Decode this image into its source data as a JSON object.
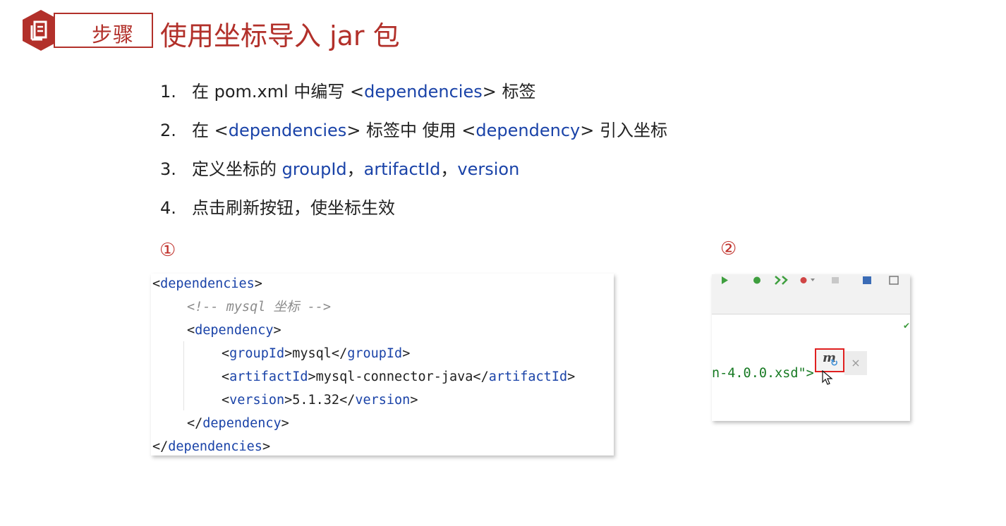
{
  "header": {
    "badge_label": "步骤",
    "title": "使用坐标导入 jar 包"
  },
  "steps": [
    {
      "num": "1.",
      "pre": "在 pom.xml 中编写 <",
      "kw1": "dependencies",
      "mid": "> 标签",
      "kw2": "",
      "post": ""
    },
    {
      "num": "2.",
      "pre": "在 <",
      "kw1": "dependencies",
      "mid": "> 标签中 使用 <",
      "kw2": "dependency",
      "post": "> 引入坐标"
    },
    {
      "num": "3.",
      "pre": "定义坐标的 ",
      "kw1": "groupId",
      "mid": "，",
      "kw2": "artifactId",
      "post": "，",
      "kw3": "version"
    },
    {
      "num": "4.",
      "pre": "点击刷新按钮，使坐标生效",
      "kw1": "",
      "mid": "",
      "kw2": "",
      "post": ""
    }
  ],
  "markers": {
    "one": "①",
    "two": "②"
  },
  "code": {
    "l1_open": "<",
    "l1_tag": "dependencies",
    "l1_close": ">",
    "l2_comment": "<!-- mysql 坐标 -->",
    "l3_open": "<",
    "l3_tag": "dependency",
    "l3_close": ">",
    "l4_open": "<",
    "l4_tag": "groupId",
    "l4_mid": ">mysql</",
    "l4_tag2": "groupId",
    "l4_close": ">",
    "l5_open": "<",
    "l5_tag": "artifactId",
    "l5_mid": ">mysql-connector-java</",
    "l5_tag2": "artifactId",
    "l5_close": ">",
    "l6_open": "<",
    "l6_tag": "version",
    "l6_mid": ">5.1.32</",
    "l6_tag2": "version",
    "l6_close": ">",
    "l7_open": "</",
    "l7_tag": "dependency",
    "l7_close": ">",
    "l8_open": "</",
    "l8_tag": "dependencies",
    "l8_close": ">"
  },
  "ide": {
    "xsd_text": "n-4.0.0.xsd\">",
    "maven_m": "m",
    "maven_refresh": "↻",
    "close_x": "×",
    "check": "✔"
  },
  "colors": {
    "accent": "#b2302a",
    "keyword": "#1a43a8",
    "string": "#177a23",
    "highlight": "#e02020"
  }
}
